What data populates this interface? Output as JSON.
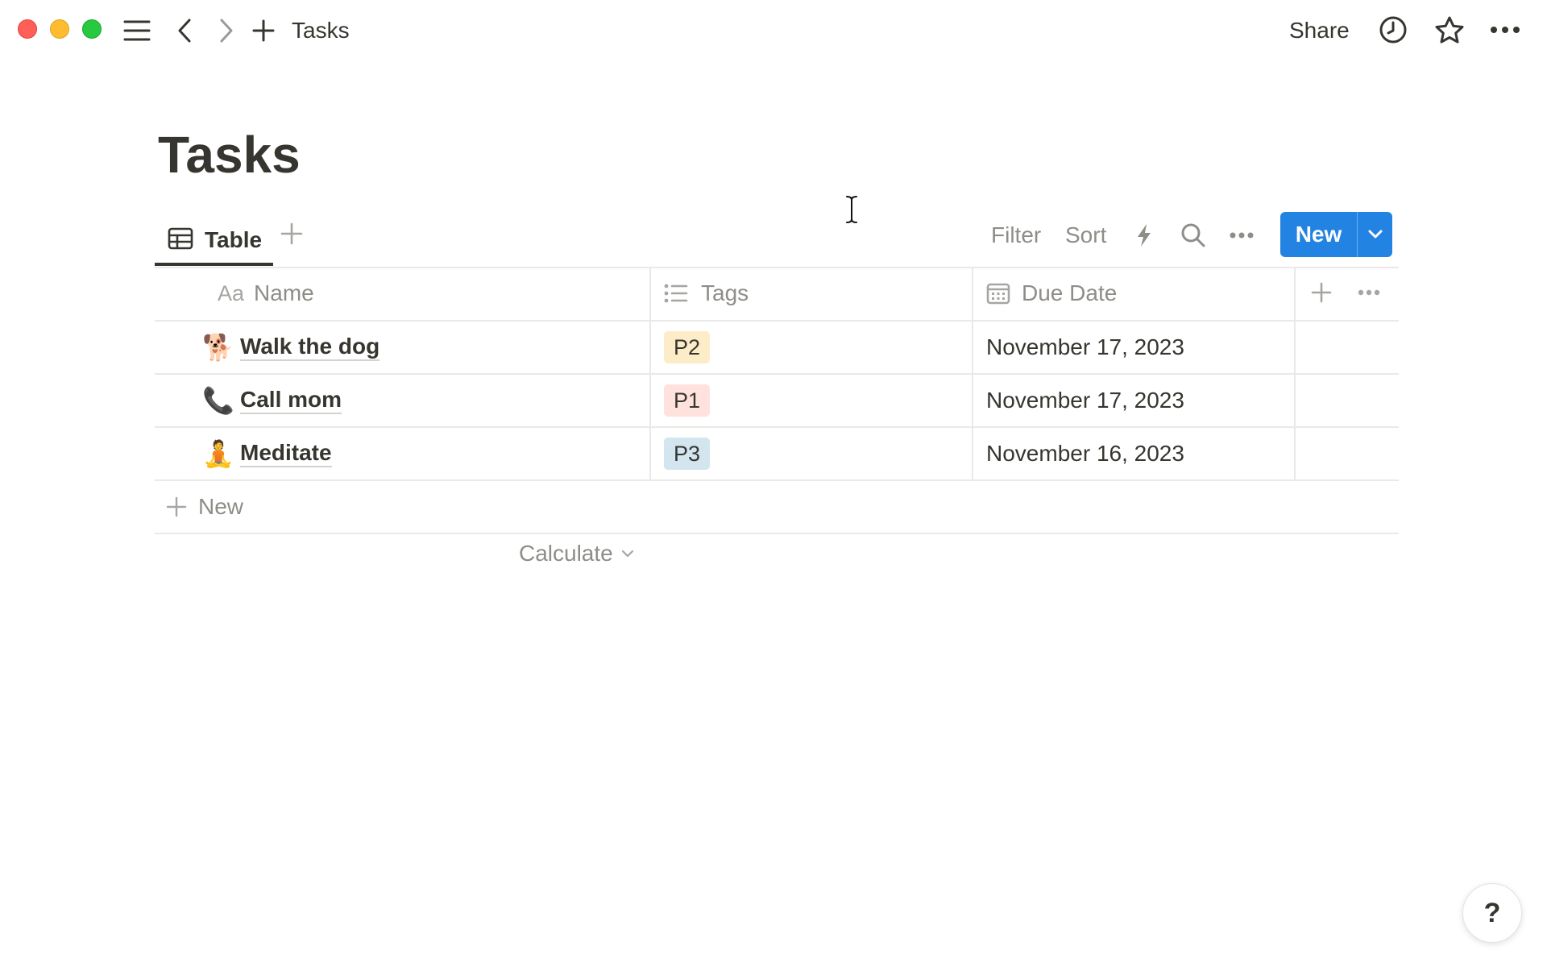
{
  "titlebar": {
    "breadcrumb": "Tasks",
    "share_label": "Share"
  },
  "page": {
    "title": "Tasks"
  },
  "views": {
    "active_tab_label": "Table"
  },
  "toolbar": {
    "filter_label": "Filter",
    "sort_label": "Sort",
    "new_label": "New"
  },
  "table": {
    "columns": [
      {
        "icon_text": "Aa",
        "label": "Name"
      },
      {
        "icon": "list-icon",
        "label": "Tags"
      },
      {
        "icon": "calendar-icon",
        "label": "Due Date"
      }
    ],
    "rows": [
      {
        "emoji": "🐕",
        "name": "Walk the dog",
        "tag": "P2",
        "tag_bg": "#fdecc8",
        "due": "November 17, 2023"
      },
      {
        "emoji": "📞",
        "name": "Call mom",
        "tag": "P1",
        "tag_bg": "#ffe2dd",
        "due": "November 17, 2023"
      },
      {
        "emoji": "🧘",
        "name": "Meditate",
        "tag": "P3",
        "tag_bg": "#d3e5ef",
        "due": "November 16, 2023"
      }
    ],
    "add_row_label": "New",
    "calculate_label": "Calculate"
  },
  "help_label": "?",
  "colors": {
    "accent": "#2383e2",
    "text": "#37352f",
    "muted": "#8f8d88",
    "border": "#e9e9e7"
  }
}
